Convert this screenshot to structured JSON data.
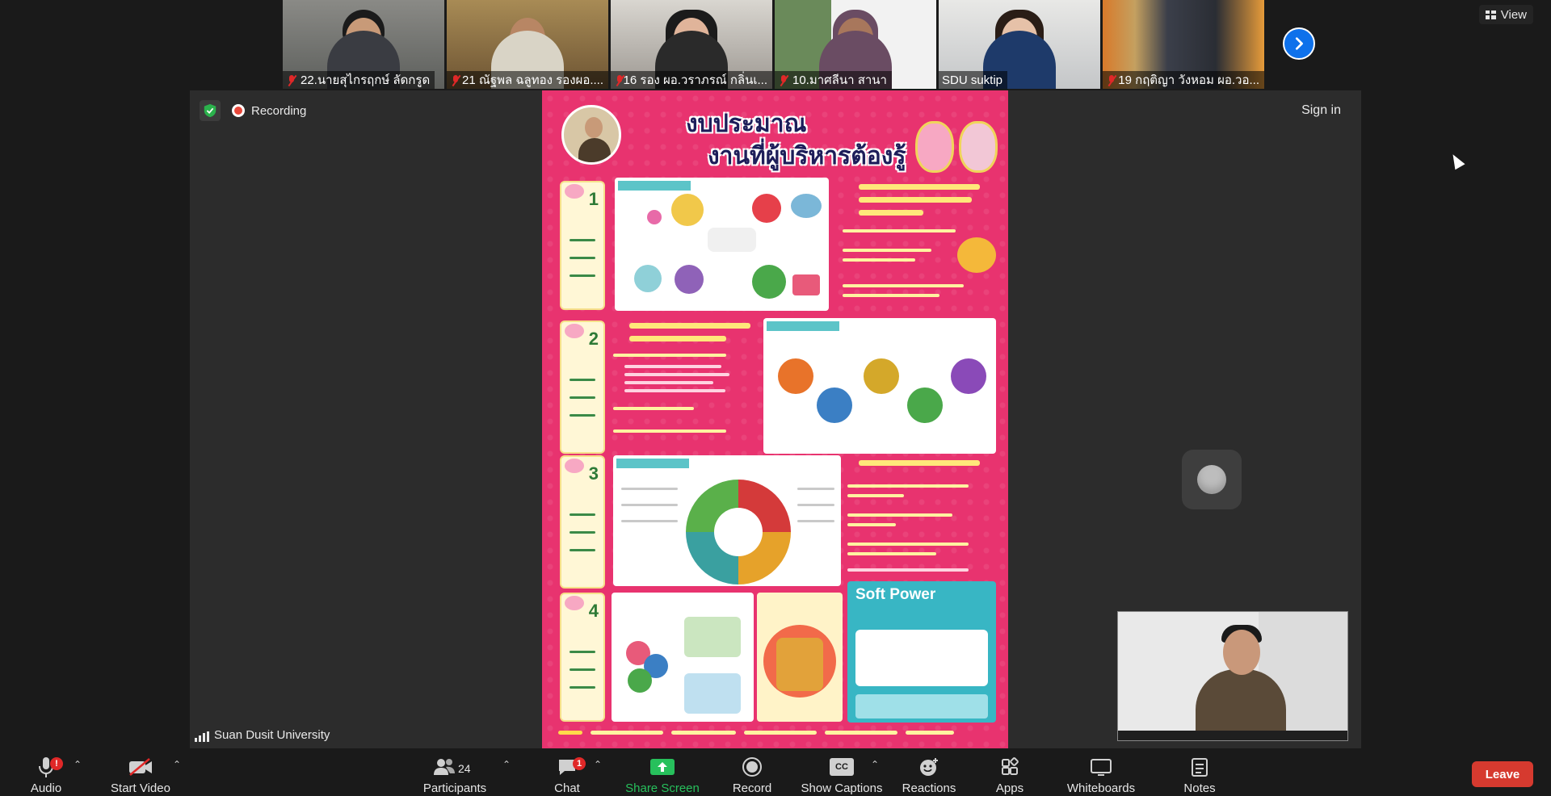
{
  "gallery": {
    "participants": [
      {
        "name": "22.นายสุไกรฤกษ์ ลัดกรูด",
        "muted": true
      },
      {
        "name": "21 ณัฐพล ฉลูทอง รองผอ....",
        "muted": true
      },
      {
        "name": "16 รอง ผอ.วราภรณ์ กลิ่นเ...",
        "muted": true
      },
      {
        "name": "10.มาศลีนา สานา",
        "muted": true
      },
      {
        "name": "SDU suktip",
        "muted": false
      },
      {
        "name": "19 กฤติญา วังหอม ผอ.วอ...",
        "muted": true
      }
    ],
    "next_icon": "chevron-right-icon"
  },
  "view_button": {
    "label": "View",
    "icon": "grid-icon"
  },
  "share": {
    "recording_label": "Recording",
    "sign_in_label": "Sign in",
    "host_name": "Suan Dusit University",
    "poster": {
      "title_line1": "งบประมาณ",
      "title_line2": "งานที่ผู้บริหารต้องรู้",
      "section_numbers": [
        "1",
        "2",
        "3",
        "4"
      ],
      "soft_power_title": "Soft Power"
    }
  },
  "toolbar": {
    "audio": {
      "label": "Audio",
      "badge": "!"
    },
    "video": {
      "label": "Start Video"
    },
    "participants": {
      "label": "Participants",
      "count": "24"
    },
    "chat": {
      "label": "Chat",
      "badge": "1"
    },
    "share_screen": {
      "label": "Share Screen"
    },
    "record": {
      "label": "Record"
    },
    "captions": {
      "label": "Show Captions",
      "icon_text": "CC"
    },
    "reactions": {
      "label": "Reactions"
    },
    "apps": {
      "label": "Apps"
    },
    "whiteboards": {
      "label": "Whiteboards"
    },
    "notes": {
      "label": "Notes"
    },
    "leave": {
      "label": "Leave"
    }
  },
  "colors": {
    "accent_blue": "#0e71eb",
    "share_green": "#27c05c",
    "leave_red": "#d63a2f",
    "poster_pink": "#e8336f"
  }
}
